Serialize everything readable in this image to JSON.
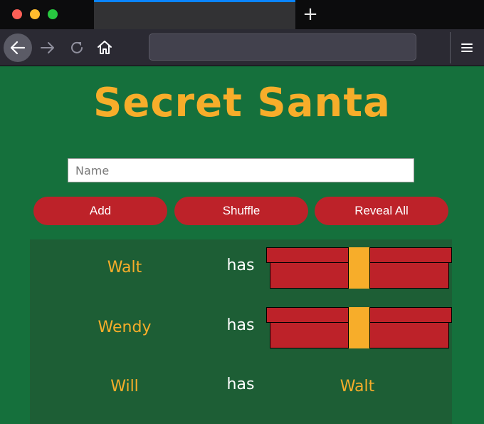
{
  "page": {
    "title": "Secret Santa",
    "name_placeholder": "Name",
    "buttons": {
      "add": "Add",
      "shuffle": "Shuffle",
      "reveal_all": "Reveal All"
    },
    "connector": "has",
    "pairs": [
      {
        "giver": "Walt",
        "recipient": "",
        "revealed": false
      },
      {
        "giver": "Wendy",
        "recipient": "",
        "revealed": false
      },
      {
        "giver": "Will",
        "recipient": "Walt",
        "revealed": true
      }
    ]
  },
  "colors": {
    "background": "#15703c",
    "panel": "#1d5e35",
    "accent": "#f7ad2a",
    "button": "#bd2229"
  }
}
